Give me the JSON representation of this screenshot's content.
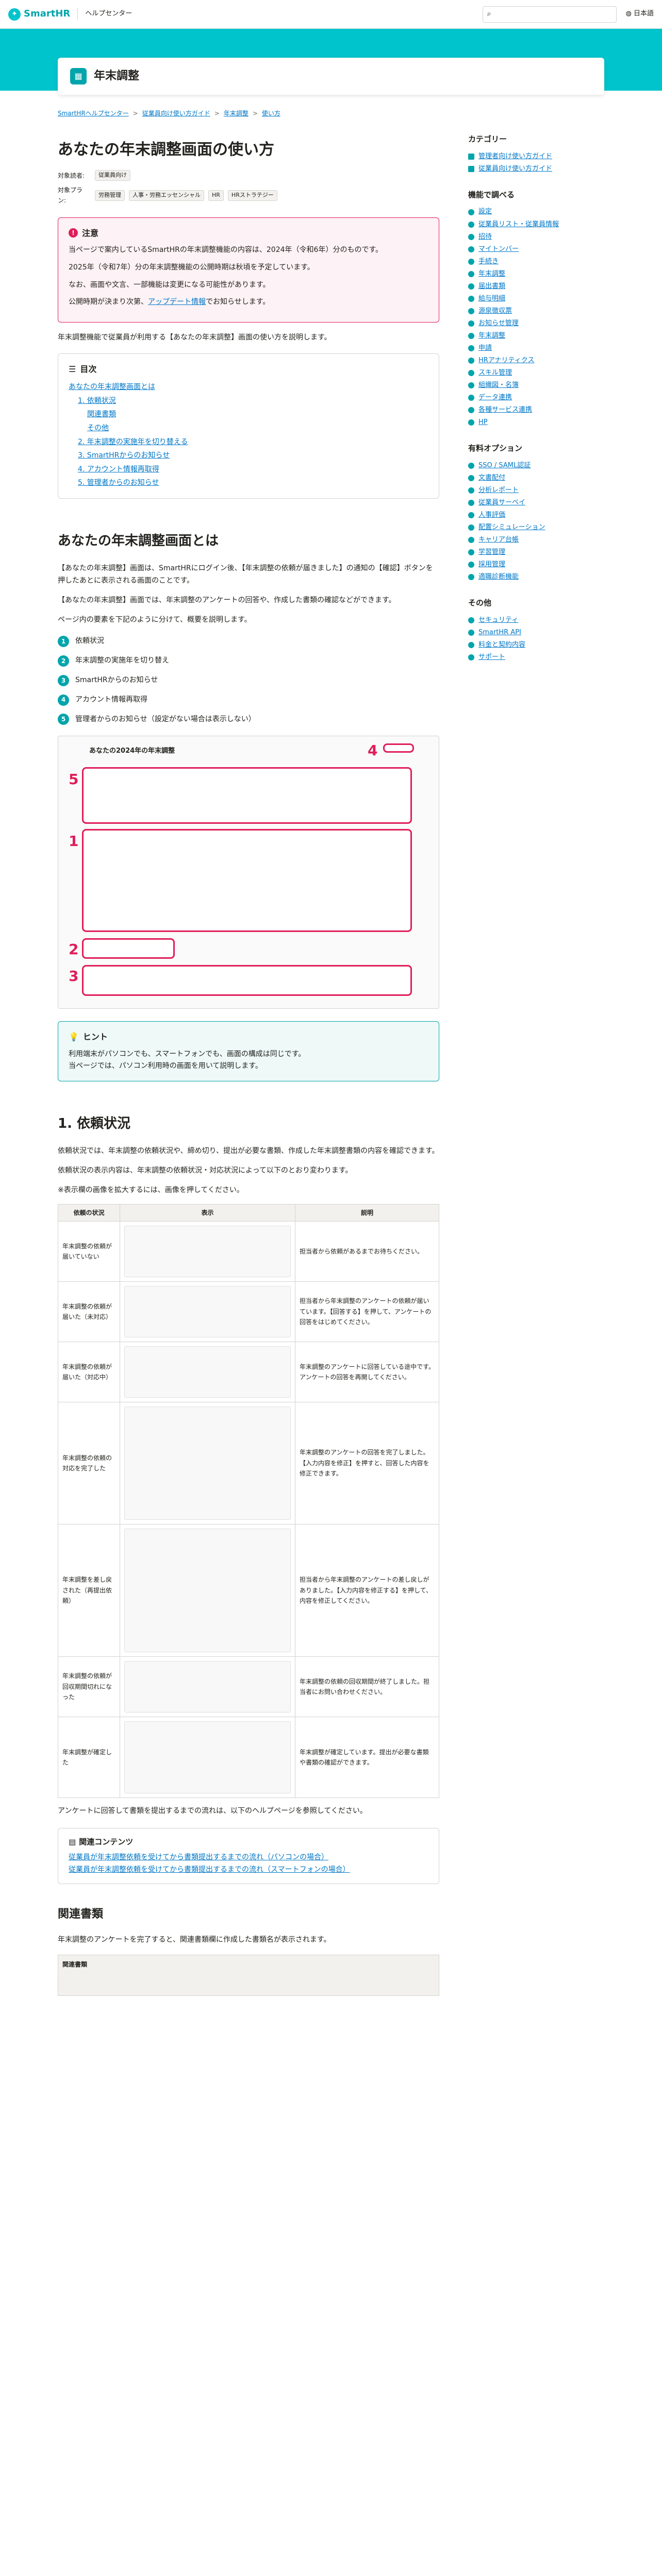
{
  "header": {
    "logo": "SmartHR",
    "help_center": "ヘルプセンター",
    "search_placeholder": "",
    "language": "日本語"
  },
  "page_title": "年末調整",
  "breadcrumb": [
    "SmartHRヘルプセンター",
    "従業員向け使い方ガイド",
    "年末調整",
    "使い方"
  ],
  "article": {
    "title": "あなたの年末調整画面の使い方",
    "target_user_label": "対象読者:",
    "target_user": "従業員向け",
    "target_plan_label": "対象プラン:",
    "plans": [
      "労務管理",
      "人事・労務エッセンシャル",
      "HR",
      "HRストラテジー"
    ],
    "notice_title": "注意",
    "notice_p1": "当ページで案内しているSmartHRの年末調整機能の内容は、2024年（令和6年）分のものです。",
    "notice_p2": "2025年（令和7年）分の年末調整機能の公開時期は秋頃を予定しています。",
    "notice_p3": "なお、画面や文言、一部機能は変更になる可能性があります。",
    "notice_p4_a": "公開時期が決まり次第、",
    "notice_p4_link": "アップデート情報",
    "notice_p4_b": "でお知らせします。",
    "intro": "年末調整機能で従業員が利用する【あなたの年末調整】画面の使い方を説明します。",
    "toc_title": "目次",
    "toc": [
      "あなたの年末調整画面とは",
      "1. 依頼状況",
      "関連書類",
      "その他",
      "2. 年末調整の実施年を切り替える",
      "3. SmartHRからのお知らせ",
      "4. アカウント情報再取得",
      "5. 管理者からのお知らせ"
    ],
    "section1_title": "あなたの年末調整画面とは",
    "section1_p1": "【あなたの年末調整】画面は、SmartHRにログイン後、【年末調整の依頼が届きました】の通知の【確認】ボタンを押したあとに表示される画面のことです。",
    "section1_p2": "【あなたの年末調整】画面では、年末調整のアンケートの回答や、作成した書類の確認などができます。",
    "section1_p3": "ページ内の要素を下記のように分けて、概要を説明します。",
    "steps": [
      "依頼状況",
      "年末調整の実施年を切り替え",
      "SmartHRからのお知らせ",
      "アカウント情報再取得",
      "管理者からのお知らせ（設定がない場合は表示しない）"
    ],
    "screenshot_title": "あなたの2024年の年末調整",
    "hint_title": "ヒント",
    "hint_p1": "利用端末がパソコンでも、スマートフォンでも、画面の構成は同じです。",
    "hint_p2": "当ページでは、パソコン利用時の画面を用いて説明します。",
    "section2_title": "1. 依頼状況",
    "section2_p1": "依頼状況では、年末調整の依頼状況や、締め切り、提出が必要な書類、作成した年末調整書類の内容を確認できます。",
    "section2_p2": "依頼状況の表示内容は、年末調整の依頼状況・対応状況によって以下のとおり変わります。",
    "section2_p3": "※表示欄の画像を拡大するには、画像を押してください。",
    "table_headers": [
      "依頼の状況",
      "表示",
      "説明"
    ],
    "table_rows": [
      {
        "state": "年末調整の依頼が届いていない",
        "desc": "担当者から依頼があるまでお待ちください。"
      },
      {
        "state": "年末調整の依頼が届いた（未対応）",
        "desc": "担当者から年末調整のアンケートの依頼が届いています。【回答する】を押して、アンケートの回答をはじめてください。"
      },
      {
        "state": "年末調整の依頼が届いた（対応中）",
        "desc": "年末調整のアンケートに回答している途中です。アンケートの回答を再開してください。"
      },
      {
        "state": "年末調整の依頼の対応を完了した",
        "desc": "年末調整のアンケートの回答を完了しました。【入力内容を修正】を押すと、回答した内容を修正できます。"
      },
      {
        "state": "年末調整を差し戻された（再提出依頼）",
        "desc": "担当者から年末調整のアンケートの差し戻しがありました。【入力内容を修正する】を押して、内容を修正してください。"
      },
      {
        "state": "年末調整の依頼が回収期間切れになった",
        "desc": "年末調整の依頼の回収期間が終了しました。担当者にお問い合わせください。"
      },
      {
        "state": "年末調整が確定した",
        "desc": "年末調整が確定しています。提出が必要な書類や書類の確認ができます。"
      }
    ],
    "section2_p4": "アンケートに回答して書類を提出するまでの流れは、以下のヘルプページを参照してください。",
    "related_title": "関連コンテンツ",
    "related_links": [
      "従業員が年末調整依頼を受けてから書類提出するまでの流れ（パソコンの場合）",
      "従業員が年末調整依頼を受けてから書類提出するまでの流れ（スマートフォンの場合）"
    ],
    "section3_title": "関連書類",
    "section3_p1": "年末調整のアンケートを完了すると、関連書類欄に作成した書類名が表示されます。",
    "docs_table_header": "関連書類"
  },
  "sidebar": {
    "category_title": "カテゴリー",
    "categories": [
      "管理者向け使い方ガイド",
      "従業員向け使い方ガイド"
    ],
    "feature_title": "機能で調べる",
    "features": [
      "設定",
      "従業員リスト・従業員情報",
      "招待",
      "マイトンバー",
      "手続き",
      "年末調整",
      "届出書類",
      "給与明細",
      "源泉徴収票",
      "お知らせ管理",
      "年末調整",
      "申請",
      "HRアナリティクス",
      "スキル管理",
      "組織図・名簿",
      "データ連携",
      "各種サービス連携",
      "HP"
    ],
    "option_title": "有料オプション",
    "options": [
      "SSO / SAML認証",
      "文書配付",
      "分析レポート",
      "従業員サーベイ",
      "人事評価",
      "配置シミュレーション",
      "キャリア台帳",
      "学習管理",
      "採用管理",
      "適職診断機能"
    ],
    "other_title": "その他",
    "others": [
      "セキュリティ",
      "SmartHR API",
      "料金と契約内容",
      "サポート"
    ]
  },
  "colors": {
    "brand": "#00c4cc",
    "accent": "#00a5ab",
    "danger": "#e01e5a",
    "link": "#0077c7"
  }
}
